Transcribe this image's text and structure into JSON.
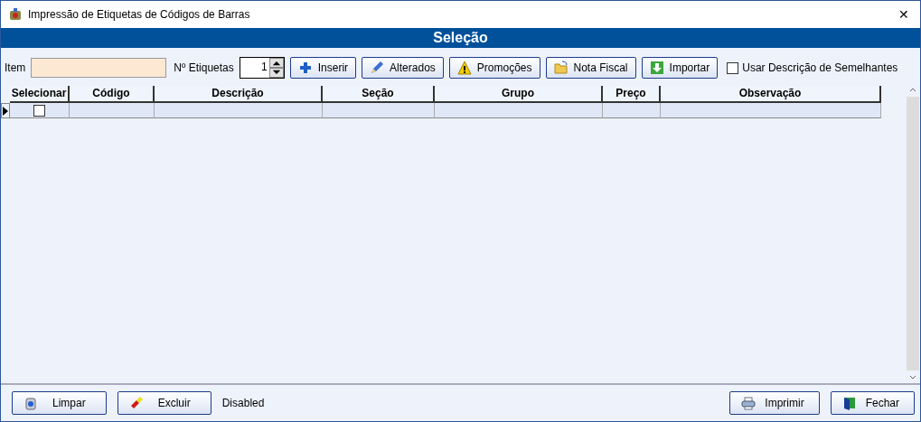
{
  "window": {
    "title": "Impressão de Etiquetas de Códigos de Barras",
    "close": "✕"
  },
  "header": {
    "title": "Seleção"
  },
  "toolbar": {
    "item_label": "Item",
    "count_label": "Nº Etiquetas",
    "count_value": "1",
    "buttons": [
      {
        "label": "Inserir",
        "kind": "plus"
      },
      {
        "label": "Alterados",
        "kind": "pencil"
      },
      {
        "label": "Promoções",
        "kind": "warning"
      },
      {
        "label": "Nota Fiscal",
        "kind": "folder"
      },
      {
        "label": "Importar",
        "kind": "download"
      }
    ],
    "similar": {
      "label": "Usar Descrição de Semelhantes",
      "checked": false
    }
  },
  "table": {
    "columns": [
      "Selecionar",
      "Código",
      "Descrição",
      "Seção",
      "Grupo",
      "Preço",
      "Observação"
    ],
    "rows": [
      {
        "current": true,
        "checked": false
      }
    ]
  },
  "footer": {
    "left_buttons": [
      {
        "label": "Limpar",
        "kind": "bin"
      },
      {
        "label": "Excluir",
        "kind": "eraser"
      }
    ],
    "status": "Disabled",
    "right_buttons": [
      {
        "label": "Imprimir",
        "kind": "printer"
      },
      {
        "label": "Fechar",
        "kind": "door"
      }
    ]
  }
}
